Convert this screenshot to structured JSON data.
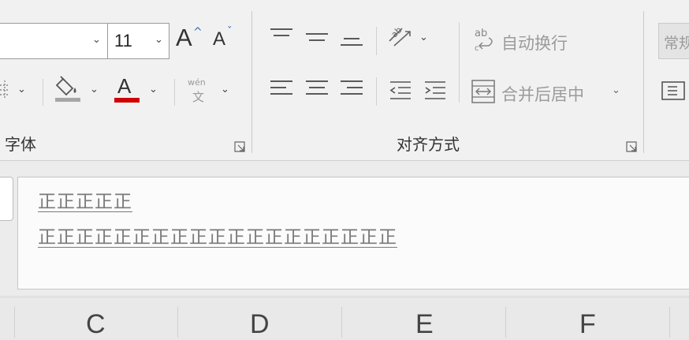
{
  "ribbon": {
    "font_group": {
      "font_size": "11",
      "label": "字体",
      "grow_font": "A",
      "shrink_font": "A",
      "font_color_letter": "A",
      "phonetic_top": "wén",
      "phonetic_bottom": "文"
    },
    "align_group": {
      "label": "对齐方式",
      "wrap_text": "自动换行",
      "merge_center": "合并后居中"
    },
    "number_group": {
      "format_value": "常规"
    },
    "colors": {
      "font_color": "#d00000",
      "fill_color": "#a6a6a6"
    }
  },
  "formula_bar": {
    "line1": "正正正正正",
    "line2": "正正正正正正正正正正正正正正正正正正正"
  },
  "column_headers": [
    "C",
    "D",
    "E",
    "F"
  ]
}
